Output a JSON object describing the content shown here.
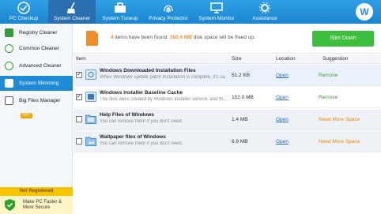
{
  "nav": {
    "items": [
      {
        "label": "PC Checkup",
        "icon": "pc-checkup-icon"
      },
      {
        "label": "System Cleaner",
        "icon": "broom-icon"
      },
      {
        "label": "System Tuneup",
        "icon": "toolbox-icon"
      },
      {
        "label": "Privacy Protector",
        "icon": "fingerprint-icon"
      },
      {
        "label": "System Monitor",
        "icon": "monitor-icon"
      },
      {
        "label": "Assistance",
        "icon": "gear-tools-icon"
      }
    ],
    "active": "System Cleaner",
    "avatar_letter": "W"
  },
  "sidebar": {
    "items": [
      {
        "label": "Registry Cleaner"
      },
      {
        "label": "Common Cleaner"
      },
      {
        "label": "Advanced Cleaner"
      },
      {
        "label": "System Slimming"
      },
      {
        "label": "Big Files Manager",
        "badge": "PRO"
      }
    ],
    "active": "System Slimming",
    "not_registered": "Not Registered",
    "promo_line1": "Make PC Faster &",
    "promo_line2": "More Secure"
  },
  "summary": {
    "count": "4",
    "text_a": " items have been found. ",
    "space": "160.4 MB",
    "text_b": " disk space will be freed up.",
    "slim_button": "Slim Down"
  },
  "table": {
    "headers": {
      "item": "Item",
      "size": "Size",
      "location": "Location",
      "suggestion": "Suggestion"
    },
    "rows": [
      {
        "checked": true,
        "title": "Windows Downloaded Installation Files",
        "desc": "When Windows update patch installation is complete, it's sa...",
        "size": "51.2 KB",
        "location": "Open",
        "suggestion": "Remove"
      },
      {
        "checked": true,
        "title": "Windows Installer Baseline Cache",
        "desc": "The files were created by Windows installer service, and th...",
        "size": "152.0 MB",
        "location": "Open",
        "suggestion": "Remove"
      },
      {
        "checked": false,
        "title": "Help Files of Windows",
        "desc": "You can remove them if you don't need.",
        "size": "1.4 MB",
        "location": "Open",
        "suggestion": "Need More Space"
      },
      {
        "checked": false,
        "title": "Wallpaper files of Windows",
        "desc": "You can remove them if you don't need.",
        "size": "6.9 MB",
        "location": "Open",
        "suggestion": "Need More Space"
      }
    ]
  },
  "colors": {
    "accent": "#1f8ad6",
    "button": "#3cbf3c",
    "highlight": "#f28c28"
  }
}
